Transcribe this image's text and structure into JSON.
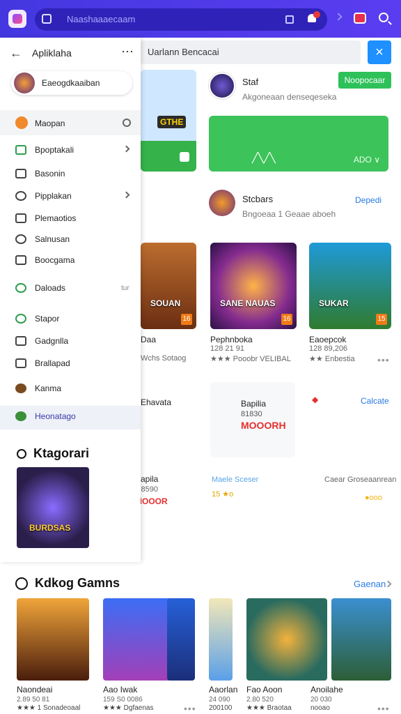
{
  "colors": {
    "topbar": "#4437e0",
    "green": "#2ec15a",
    "link": "#2a7ae2",
    "badge": "#f07b16"
  },
  "topbar": {
    "search_placeholder": "Naashaaaecaam"
  },
  "main": {
    "search_value": "Uarlann Bencacai",
    "banner": {
      "logo_text": "GTHE"
    },
    "story": {
      "title": "Staf",
      "subtitle": "Akgoneaan denseqeseka",
      "follow_label": "Noopocaar"
    },
    "stat_card": {
      "meta": "ADO ∨"
    },
    "store": {
      "title": "Stcbars",
      "subtitle": "Bngoeaa 1 Geaae aboeh",
      "link": "Depedi"
    },
    "tiles": [
      {
        "label": "SOUAN",
        "title": "Daa",
        "sub": "Wchs Sotaog",
        "badge": "16"
      },
      {
        "label": "SANE NAUAS",
        "title": "Pephnboka",
        "sub": "★★★ Pooobr VELIBAL",
        "size": "128 21 91",
        "badge": "16"
      },
      {
        "label": "SUKAR",
        "title": "Eaoepcok",
        "sub": "★★ Enbestia",
        "size": "128 89,206",
        "badge": "15"
      }
    ],
    "bottom_panel": {
      "t1": "Bapilia",
      "t2": "81830",
      "t3": "MOOORH"
    },
    "row_left": {
      "title": "Bapila",
      "sub": "Q8590",
      "t3": "MOOOR",
      "col2": "Maele Sceser",
      "col3": "Caear Groseaanrean"
    },
    "rapids": "Ehavata",
    "calc": "Calcate"
  },
  "drawer": {
    "title": "Apliklaha",
    "account_name": "Eaeogdkaaiban",
    "search_label": "Maopan",
    "items": [
      {
        "label": "Bpoptakali",
        "chev": true
      },
      {
        "label": "Basonin"
      },
      {
        "label": "Pipplakan",
        "chev": true
      },
      {
        "label": "Plemaotios"
      },
      {
        "label": "Salnusan"
      },
      {
        "label": "Boocgama"
      },
      {
        "label": "Daloads",
        "right": "tur"
      },
      {
        "label": "Stapor"
      },
      {
        "label": "Gadgnlla"
      },
      {
        "label": "Brallapad"
      },
      {
        "label": "Kanma"
      },
      {
        "label": "Heonatago"
      }
    ],
    "category_title": "Ktagorari",
    "category_tile": "BURDSAS"
  },
  "section": {
    "title": "Kdkog Gamns",
    "link": "Gaenan",
    "games": [
      {
        "name": "Naondeai",
        "size": "2.89 50 81",
        "rating": "★★★ 1 Sonadeoaal"
      },
      {
        "name": "Aao Iwak",
        "size": "159 S0 0086",
        "rating": "★★★ Dgfaenas"
      },
      {
        "name": "Aaorlan",
        "size": "24 090",
        "rating": "200100"
      },
      {
        "name": "Fao Aoon",
        "size": "2.80 520",
        "rating": "★★★ Braotaa"
      },
      {
        "name": "Anoilahe",
        "size": "20 030",
        "rating": "nooao"
      }
    ]
  }
}
